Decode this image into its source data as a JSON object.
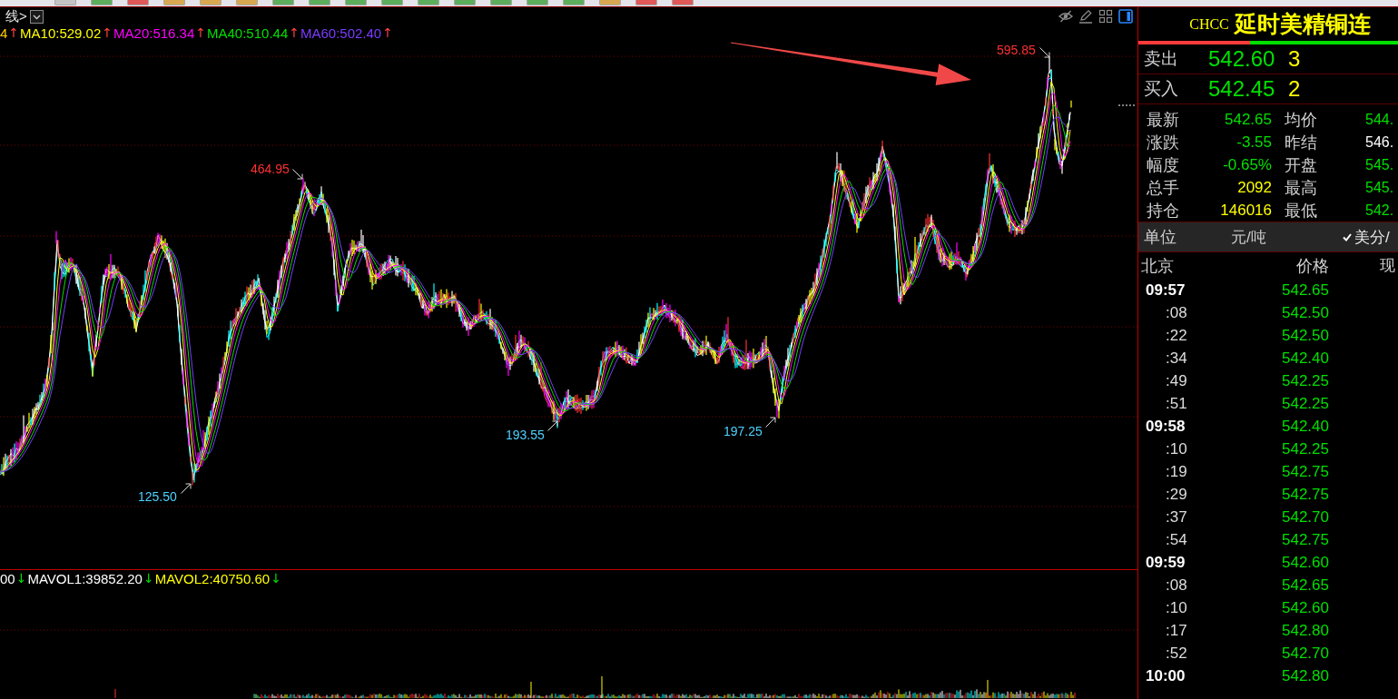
{
  "price_pane": {
    "title": "线>",
    "ma_legend": [
      {
        "label": "4",
        "color": "#ffcc00",
        "arrow": "↑",
        "rising": true
      },
      {
        "label": "MA10:529.02",
        "color": "#ffff00",
        "arrow": "↑",
        "rising": true
      },
      {
        "label": "MA20:516.34",
        "color": "#ff00ff",
        "arrow": "↑",
        "rising": true
      },
      {
        "label": "MA40:510.44",
        "color": "#00e000",
        "arrow": "↑",
        "rising": true
      },
      {
        "label": "MA60:502.40",
        "color": "#7b3cff",
        "arrow": "↑",
        "rising": true
      }
    ],
    "markers": [
      {
        "label": "595.85",
        "kind": "high"
      },
      {
        "label": "464.95",
        "kind": "high"
      },
      {
        "label": "193.55",
        "kind": "low"
      },
      {
        "label": "197.25",
        "kind": "low"
      },
      {
        "label": "125.50",
        "kind": "low"
      }
    ]
  },
  "volume_pane": {
    "legend": [
      {
        "label": "00",
        "color": "#ffffff",
        "arrow": "↓",
        "rising": false
      },
      {
        "label": "MAVOL1:39852.20",
        "color": "#ffffff",
        "arrow": "↓",
        "rising": false
      },
      {
        "label": "MAVOL2:40750.60",
        "color": "#ffff00",
        "arrow": "↓",
        "rising": false
      }
    ]
  },
  "quote_panel": {
    "symbol": "CHCC",
    "name": "延时美精铜连",
    "ratio_bar": {
      "level": 0.43
    },
    "order_book": [
      {
        "label": "卖出",
        "price": "542.60",
        "volume": "3"
      },
      {
        "label": "买入",
        "price": "542.45",
        "volume": "2"
      }
    ],
    "stats": [
      {
        "label": "最新",
        "value": "542.65",
        "color": "#00e000"
      },
      {
        "label": "均价",
        "value": "544.",
        "color": "#00e000"
      },
      {
        "label": "涨跌",
        "value": "-3.55",
        "color": "#00e000"
      },
      {
        "label": "昨结",
        "value": "546.",
        "color": "#ffffff"
      },
      {
        "label": "幅度",
        "value": "-0.65%",
        "color": "#00e000"
      },
      {
        "label": "开盘",
        "value": "545.",
        "color": "#00e000"
      },
      {
        "label": "总手",
        "value": "2092",
        "color": "#ffff00"
      },
      {
        "label": "最高",
        "value": "545.",
        "color": "#00e000"
      },
      {
        "label": "持仓",
        "value": "146016",
        "color": "#ffff00"
      },
      {
        "label": "最低",
        "value": "542.",
        "color": "#00e000"
      }
    ],
    "unit": {
      "label": "单位",
      "options": [
        {
          "label": "元/吨",
          "selected": false
        },
        {
          "label": "美分/",
          "selected": true
        }
      ]
    },
    "ticks": {
      "columns": [
        "北京",
        "价格",
        "现"
      ],
      "rows": [
        {
          "time": "09:57",
          "kind": "minute",
          "price": "542.65"
        },
        {
          "time": ":08",
          "kind": "second",
          "price": "542.50"
        },
        {
          "time": ":22",
          "kind": "second",
          "price": "542.50"
        },
        {
          "time": ":34",
          "kind": "second",
          "price": "542.40"
        },
        {
          "time": ":49",
          "kind": "second",
          "price": "542.25"
        },
        {
          "time": ":51",
          "kind": "second",
          "price": "542.25"
        },
        {
          "time": "09:58",
          "kind": "minute",
          "price": "542.40"
        },
        {
          "time": ":10",
          "kind": "second",
          "price": "542.25"
        },
        {
          "time": ":19",
          "kind": "second",
          "price": "542.75"
        },
        {
          "time": ":29",
          "kind": "second",
          "price": "542.75"
        },
        {
          "time": ":37",
          "kind": "second",
          "price": "542.70"
        },
        {
          "time": ":54",
          "kind": "second",
          "price": "542.75"
        },
        {
          "time": "09:59",
          "kind": "minute",
          "price": "542.60"
        },
        {
          "time": ":08",
          "kind": "second",
          "price": "542.65"
        },
        {
          "time": ":10",
          "kind": "second",
          "price": "542.60"
        },
        {
          "time": ":17",
          "kind": "second",
          "price": "542.80"
        },
        {
          "time": ":52",
          "kind": "second",
          "price": "542.70"
        },
        {
          "time": "10:00",
          "kind": "minute",
          "price": "542.80"
        }
      ]
    }
  }
}
